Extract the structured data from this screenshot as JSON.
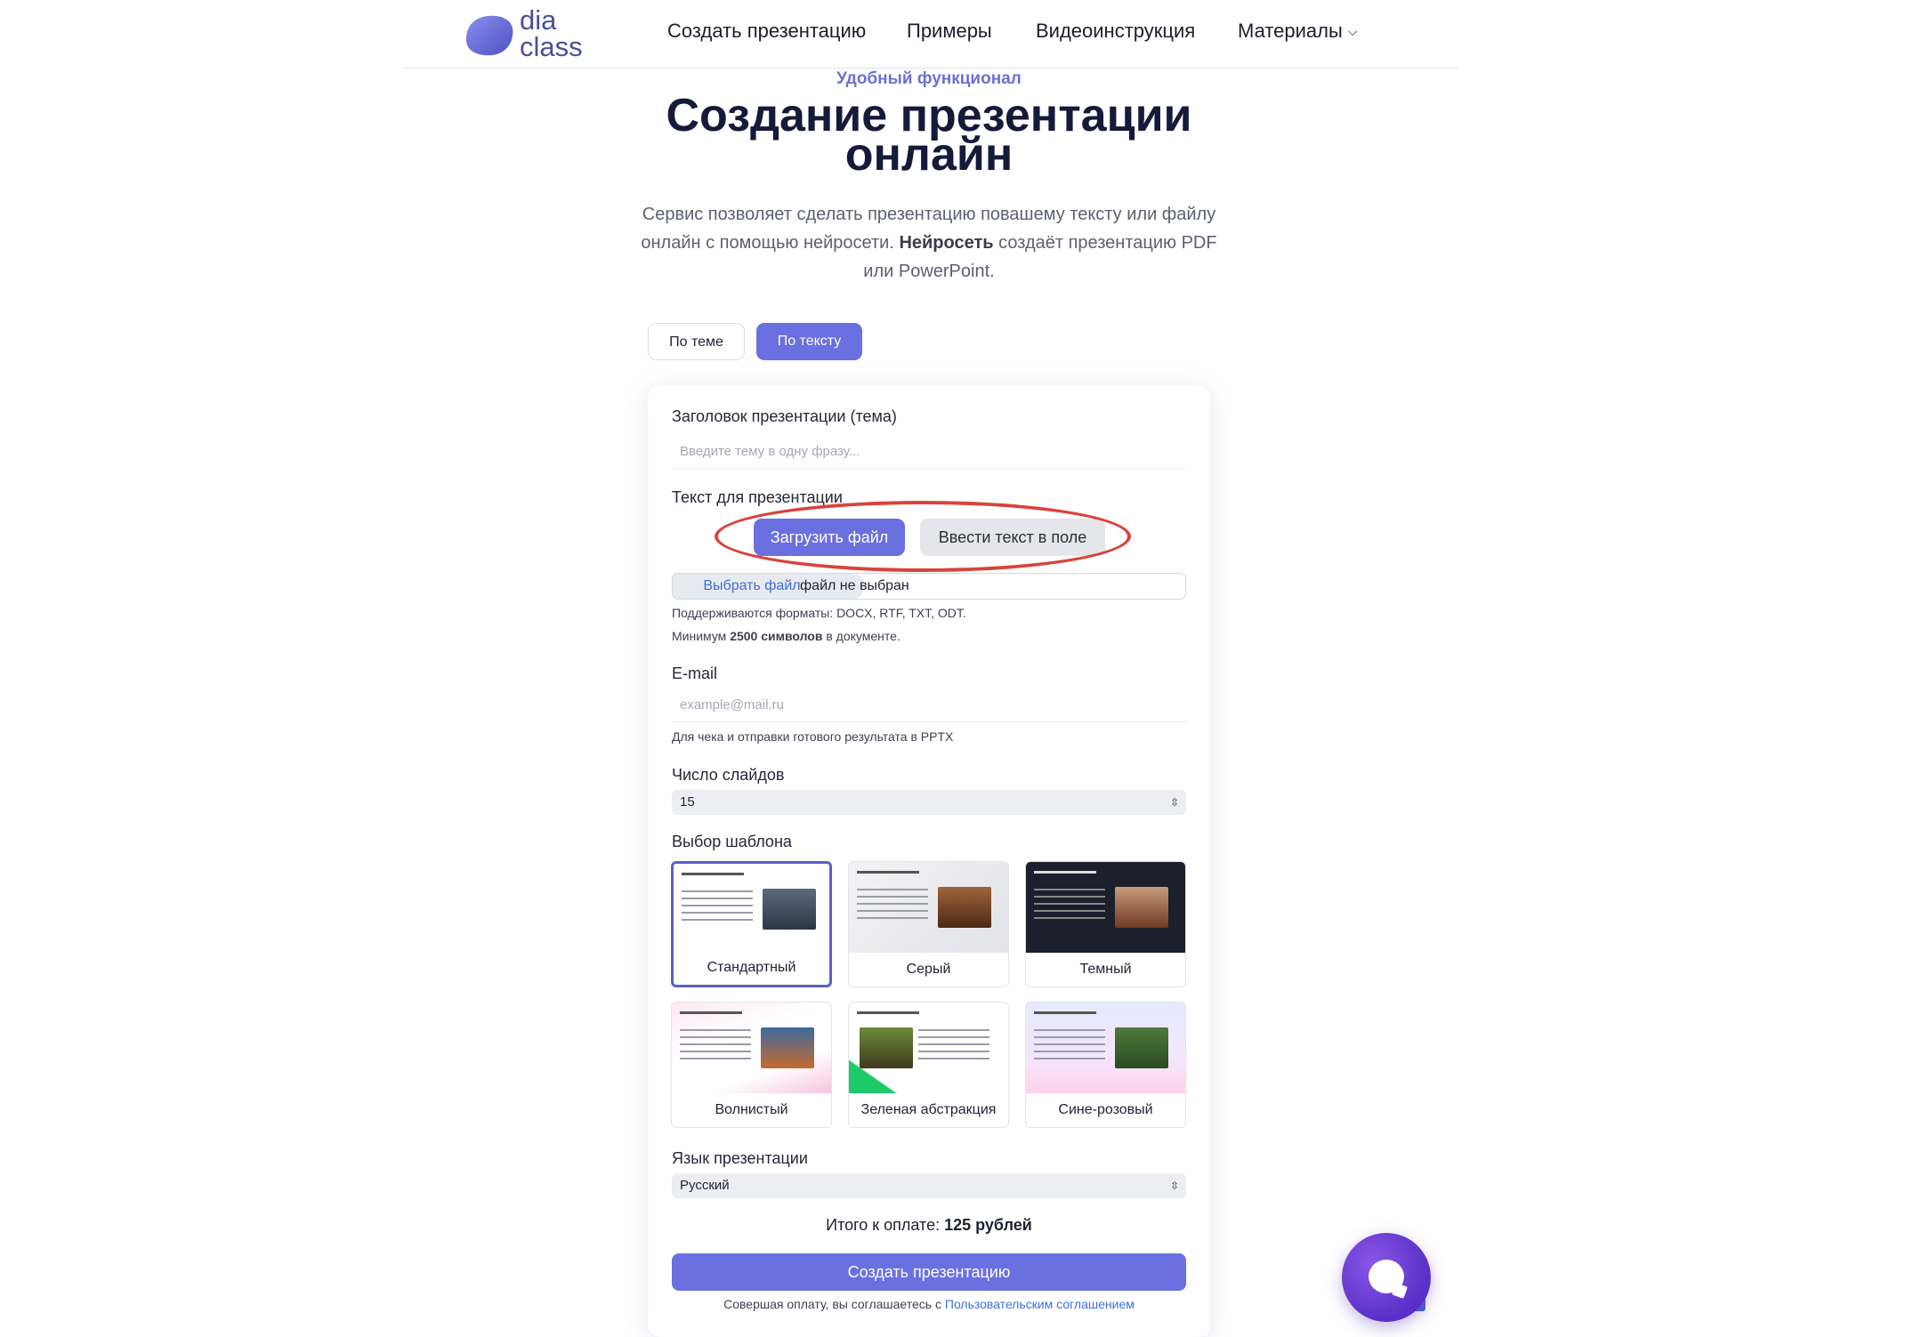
{
  "header": {
    "logo": {
      "line1": "dia",
      "line2": "class"
    },
    "nav": [
      {
        "label": "Создать презентацию"
      },
      {
        "label": "Примеры"
      },
      {
        "label": "Видеоинструкция"
      },
      {
        "label": "Материалы"
      }
    ]
  },
  "hero": {
    "eyebrow": "Удобный функционал",
    "title_line1": "Создание презентации",
    "title_line2": "онлайн",
    "desc_part1": "Сервис позволяет сделать презентацию повашему тексту или файлу онлайн с помощью нейросети. ",
    "desc_bold": "Нейросеть",
    "desc_part2": " создаёт презентацию PDF или PowerPoint."
  },
  "tabs": [
    {
      "label": "По теме",
      "active": false
    },
    {
      "label": "По тексту",
      "active": true
    }
  ],
  "form": {
    "title_label": "Заголовок презентации (тема)",
    "title_placeholder": "Введите тему в одну фразу...",
    "text_label": "Текст для презентации",
    "upload_button": "Загрузить файл",
    "enter_text_button": "Ввести текст в поле",
    "file_button": "Выбрать файл",
    "file_status": "файл не выбран",
    "formats_hint": "Поддерживаются форматы: DOCX, RTF, TXT, ODT.",
    "min_hint_prefix": "Минимум ",
    "min_hint_bold": "2500 символов",
    "min_hint_suffix": " в документе.",
    "email_label": "E-mail",
    "email_placeholder": "example@mail.ru",
    "email_hint": "Для чека и отправки готового результата в PPTX",
    "slides_label": "Число слайдов",
    "slides_value": "15",
    "template_label": "Выбор шаблона",
    "templates": [
      {
        "name": "Стандартный",
        "selected": true
      },
      {
        "name": "Серый",
        "selected": false
      },
      {
        "name": "Темный",
        "selected": false
      },
      {
        "name": "Волнистый",
        "selected": false
      },
      {
        "name": "Зеленая абстракция",
        "selected": false
      },
      {
        "name": "Сине-розовый",
        "selected": false
      }
    ],
    "language_label": "Язык презентации",
    "language_value": "Русский",
    "total_prefix": "Итого к оплате: ",
    "total_value": "125 рублей",
    "create_button": "Создать презентацию",
    "agree_prefix": "Совершая оплату, вы соглашаетесь с ",
    "agree_link": "Пользовательским соглашением"
  },
  "colors": {
    "accent": "#6b70e0",
    "highlight_ellipse": "#d9433c",
    "chat_bubble": "#6a3fd6"
  }
}
